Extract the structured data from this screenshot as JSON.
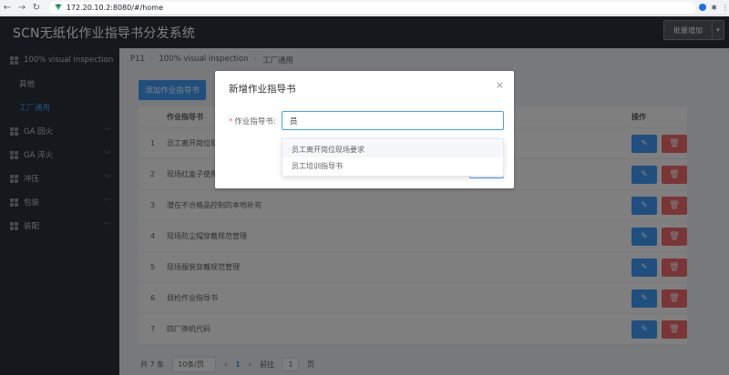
{
  "browser": {
    "url": "172.20.10.2:8080/#/home"
  },
  "header": {
    "title": "SCN无纸化作业指导书分发系统",
    "batch_button": "批量增加"
  },
  "sidebar": {
    "items": [
      {
        "label": "100% visual inspection",
        "expanded": true
      },
      {
        "label": "GA 回火"
      },
      {
        "label": "GA 淬火"
      },
      {
        "label": "冲压"
      },
      {
        "label": "包装"
      },
      {
        "label": "装配"
      }
    ],
    "subitems": [
      {
        "label": "其他",
        "active": false
      },
      {
        "label": "工厂通用",
        "active": true
      }
    ]
  },
  "breadcrumb": [
    "P11",
    "100% visual inspection",
    "工厂通用"
  ],
  "toolbar": {
    "add_label": "添加作业指导书"
  },
  "table": {
    "columns": {
      "name": "作业指导书",
      "ops": "操作"
    },
    "rows": [
      {
        "idx": "1",
        "name": "员工离开岗位现场"
      },
      {
        "idx": "2",
        "name": "现场红盒子使用的"
      },
      {
        "idx": "3",
        "name": "潜在不合格品控制的本地补充"
      },
      {
        "idx": "4",
        "name": "现场防尘帽穿戴规范管理"
      },
      {
        "idx": "5",
        "name": "现场服装穿戴规范管理"
      },
      {
        "idx": "6",
        "name": "目检作业指导书"
      },
      {
        "idx": "7",
        "name": "四厂停机代码"
      }
    ]
  },
  "pagination": {
    "total": "共 7 条",
    "page_size": "10条/页",
    "current": "1",
    "goto": "前往",
    "goto_value": "1",
    "page_unit": "页"
  },
  "dialog": {
    "title": "新增作业指导书",
    "field_label": "作业指导书:",
    "input_value": "员",
    "suggestions": [
      "员工离开岗位现场要求",
      "员工培训指导书"
    ]
  },
  "colors": {
    "primary": "#409eff",
    "danger": "#f56c6c",
    "sidebar_bg": "#2b3138",
    "header_bg": "#2a3038"
  }
}
